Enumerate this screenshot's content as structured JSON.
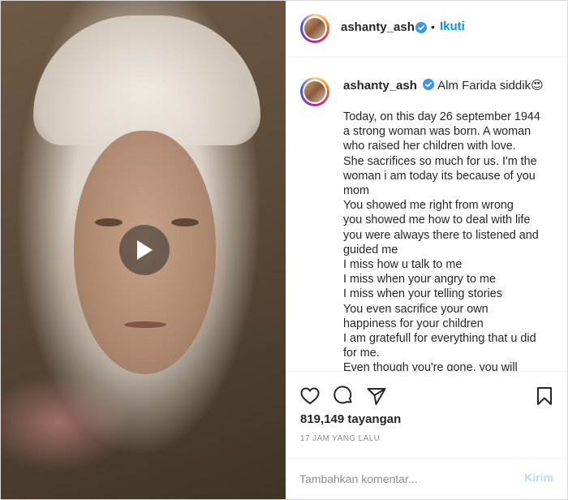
{
  "post": {
    "author": "ashanty_ash",
    "follow_label": "Ikuti",
    "separator": "•",
    "caption_head": "Alm Farida siddik😍",
    "caption_body": "Today, on this day 26 september 1944\na strong woman was born. A woman\nwho raised her children with love.\nShe sacrifices so much for us. I'm the\nwoman i am today its because of you\nmom\nYou showed me right from wrong\nyou showed me how to deal with life\nyou were always there to listened and\nguided me\nI miss how u talk to me\nI miss when your angry to me\nI miss when your telling stories\nYou even sacrifice your own\nhappiness for your children\nI am gratefull for everything that u did\nfor me.\nEven though you're gone, you will",
    "views": "819,149 tayangan",
    "time_ago": "17 JAM YANG LALU"
  },
  "comment": {
    "placeholder": "Tambahkan komentar...",
    "send_label": "Kirim"
  },
  "icons": {
    "like": "heart-icon",
    "comment": "comment-icon",
    "share": "share-icon",
    "save": "bookmark-icon",
    "play": "play-icon",
    "verified": "verified-badge-icon"
  },
  "colors": {
    "link_blue": "#0095f6",
    "send_disabled": "#b2dffc",
    "verified_blue": "#3897f0",
    "muted": "#8e8e8e"
  }
}
